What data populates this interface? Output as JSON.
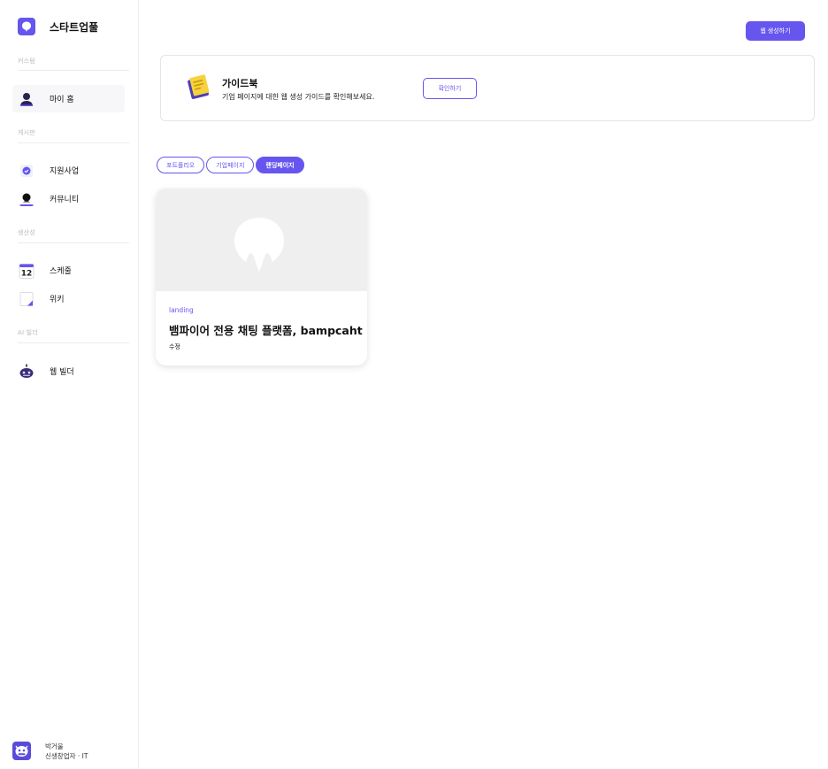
{
  "brand": {
    "name": "스타트업풀"
  },
  "sidebar": {
    "sections": [
      {
        "label": "커스텀"
      },
      {
        "label": "게시판"
      },
      {
        "label": "생산성"
      },
      {
        "label": "AI 빌더"
      }
    ],
    "items": [
      {
        "label": "마이 홈",
        "icon": "user-icon"
      },
      {
        "label": "지원사업",
        "icon": "badge-check-icon"
      },
      {
        "label": "커뮤니티",
        "icon": "chat-user-icon"
      },
      {
        "label": "스케줄",
        "icon": "calendar-icon",
        "calendar_day": "12"
      },
      {
        "label": "위키",
        "icon": "note-icon"
      },
      {
        "label": "웹 빌더",
        "icon": "robot-icon"
      }
    ]
  },
  "profile": {
    "name": "박거울",
    "role": "신생창업자 · IT"
  },
  "header": {
    "create_button": "웹 생성하기"
  },
  "guide": {
    "title": "가이드북",
    "description": "기업 페이지에 대한 웹 생성 가이드를 확인해보세요.",
    "button": "확인하기"
  },
  "tabs": [
    {
      "label": "포트폴리오",
      "active": false
    },
    {
      "label": "기업페이지",
      "active": false
    },
    {
      "label": "랜딩페이지",
      "active": true
    }
  ],
  "cards": [
    {
      "type": "landing",
      "title": "뱀파이어 전용 채팅 플랫폼, bampcaht",
      "edit": "수정"
    }
  ],
  "colors": {
    "accent": "#6655ee",
    "thumb_bg": "#efefef"
  }
}
